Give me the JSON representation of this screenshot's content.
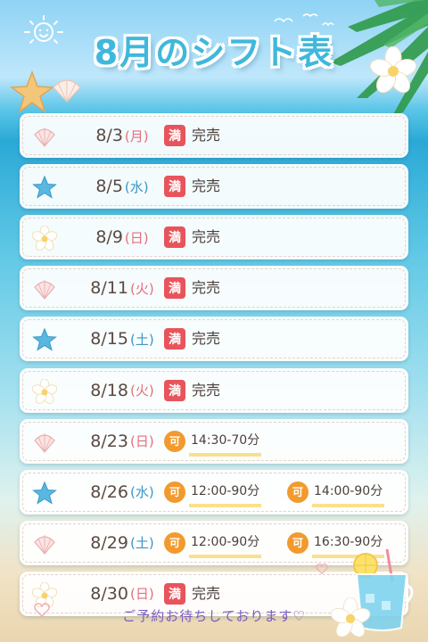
{
  "title": "8月のシフト表",
  "footer_message": "ご予約お待ちしております♡",
  "full_badge": "満",
  "available_badge": "可",
  "colors": {
    "title": "#3fb8dc",
    "full_badge": "#e8545b",
    "available_badge": "#f29a2e",
    "sunday_saturday_day": "#e46f7a",
    "weekday_day": "#3a97c7",
    "footer": "#7b5bc0",
    "time_underline": "#fbe08c"
  },
  "shifts": [
    {
      "date": "8/3",
      "day": "(月)",
      "day_color": "pink",
      "icon": "shell-icon",
      "status": "full",
      "status_text": "完売"
    },
    {
      "date": "8/5",
      "day": "(水)",
      "day_color": "blue",
      "icon": "starfish-icon",
      "status": "full",
      "status_text": "完売"
    },
    {
      "date": "8/9",
      "day": "(日)",
      "day_color": "pink",
      "icon": "plumeria-icon",
      "status": "full",
      "status_text": "完売"
    },
    {
      "date": "8/11",
      "day": "(火)",
      "day_color": "pink",
      "icon": "shell-icon",
      "status": "full",
      "status_text": "完売"
    },
    {
      "date": "8/15",
      "day": "(土)",
      "day_color": "blue",
      "icon": "starfish-icon",
      "status": "full",
      "status_text": "完売"
    },
    {
      "date": "8/18",
      "day": "(火)",
      "day_color": "pink",
      "icon": "plumeria-icon",
      "status": "full",
      "status_text": "完売"
    },
    {
      "date": "8/23",
      "day": "(日)",
      "day_color": "pink",
      "icon": "shell-icon",
      "status": "available",
      "slots": [
        "14:30-70分"
      ]
    },
    {
      "date": "8/26",
      "day": "(水)",
      "day_color": "blue",
      "icon": "starfish-icon",
      "status": "available",
      "slots": [
        "12:00-90分",
        "14:00-90分"
      ]
    },
    {
      "date": "8/29",
      "day": "(土)",
      "day_color": "blue",
      "icon": "shell-icon",
      "status": "available",
      "slots": [
        "12:00-90分",
        "16:30-90分"
      ]
    },
    {
      "date": "8/30",
      "day": "(日)",
      "day_color": "pink",
      "icon": "plumeria-icon",
      "status": "full",
      "status_text": "完売"
    }
  ]
}
